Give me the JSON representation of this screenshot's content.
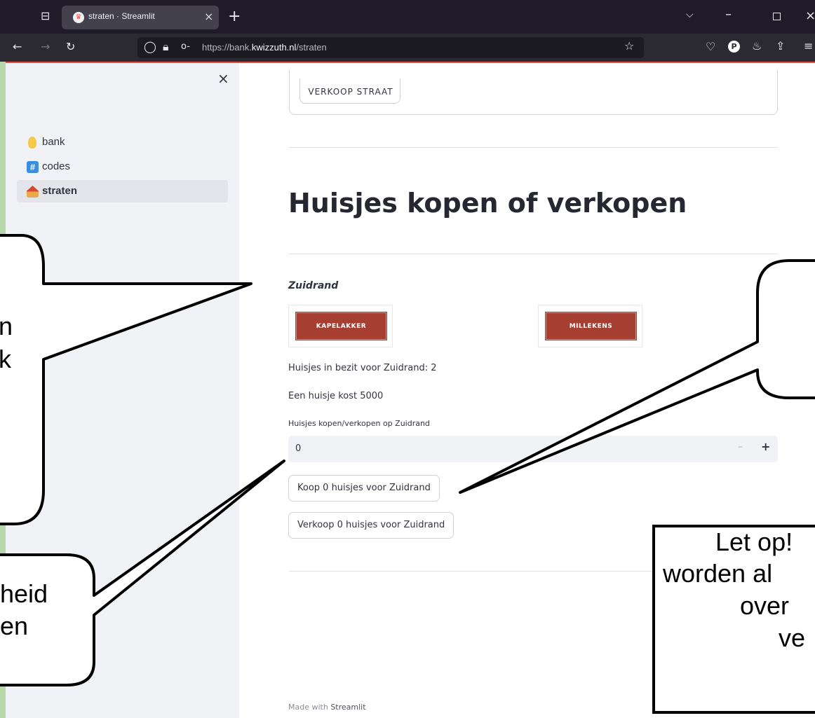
{
  "browser": {
    "tab_title": "straten · Streamlit",
    "url_prefix": "https://bank.",
    "url_domain": "kwizzuth.nl",
    "url_path": "/straten"
  },
  "sidebar": {
    "items": [
      {
        "label": "bank",
        "icon": "lightbulb-icon"
      },
      {
        "label": "codes",
        "icon": "hash-icon"
      },
      {
        "label": "straten",
        "icon": "house-icon"
      }
    ]
  },
  "main": {
    "top_button": "VERKOOP STRAAT",
    "heading": "Huisjes kopen of verkopen",
    "zone": "Zuidrand",
    "cards": [
      "KAPELAKKER",
      "MILLEKENS"
    ],
    "owned_text": "Huisjes in bezit voor Zuidrand: 2",
    "price_text": "Een huisje kost 5000",
    "input_label": "Huisjes kopen/verkopen op Zuidrand",
    "input_value": "0",
    "buy_button": "Koop 0 huisjes voor Zuidrand",
    "sell_button": "Verkoop 0 huisjes voor Zuidrand",
    "footer_prefix": "Made with ",
    "footer_brand": "Streamlit"
  },
  "annotations": {
    "bubble_left_top_line1": "n",
    "bubble_left_top_line2": "k",
    "bubble_bottom_left_line1": "heid",
    "bubble_bottom_left_line2": "en",
    "bubble_bottom_right_line1": "Let op!",
    "bubble_bottom_right_line2": "worden al",
    "bubble_bottom_right_line3": "over",
    "bubble_bottom_right_line4": "ve"
  },
  "colors": {
    "accent_red": "#a63f31",
    "sidebar_bg": "#f0f2f6"
  }
}
